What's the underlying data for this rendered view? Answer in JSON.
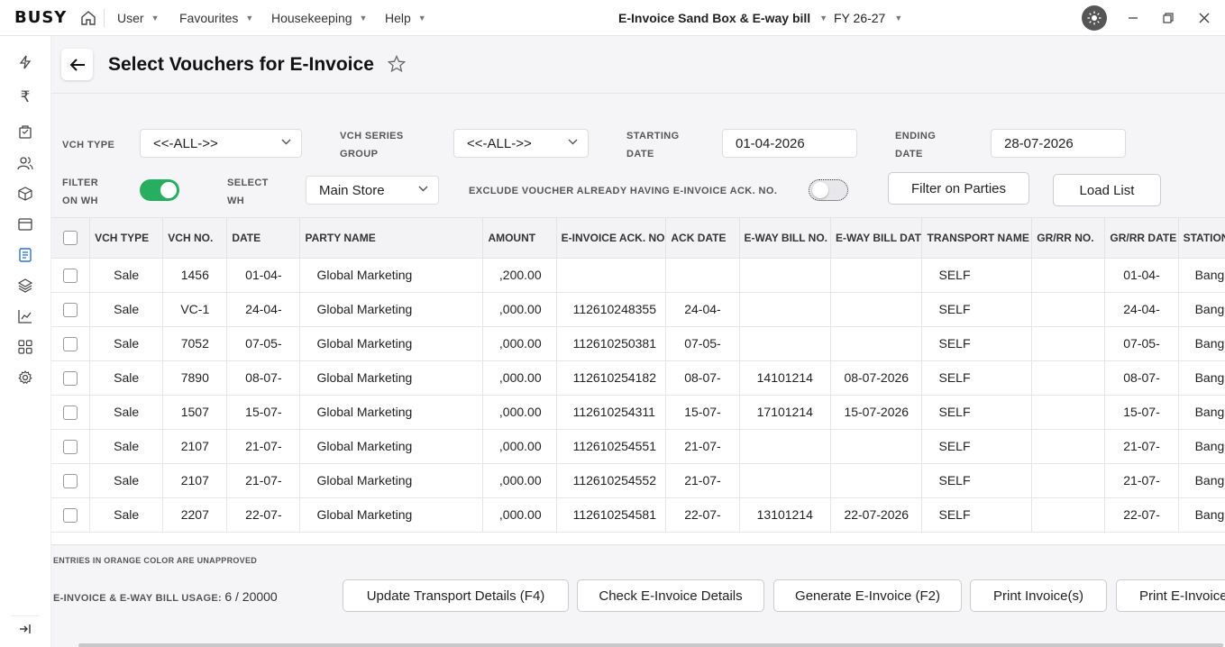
{
  "app": {
    "logo": "BUSY",
    "menus": [
      "User",
      "Favourites",
      "Housekeeping",
      "Help"
    ],
    "company": "E-Invoice Sand Box & E-way bill",
    "fy": "FY 26-27"
  },
  "page": {
    "title": "Select Vouchers for E-Invoice"
  },
  "filters": {
    "vch_type_label": "VCH TYPE",
    "vch_type_value": "<<-ALL->>",
    "vch_series_label_1": "VCH SERIES",
    "vch_series_label_2": "GROUP",
    "vch_series_value": "<<-ALL->>",
    "starting_label_1": "STARTING",
    "starting_label_2": "DATE",
    "starting_value": "01-04-2026",
    "ending_label_1": "ENDING",
    "ending_label_2": "DATE",
    "ending_value": "28-07-2026",
    "filter_wh_label_1": "FILTER",
    "filter_wh_label_2": "ON WH",
    "filter_wh_on": true,
    "select_wh_label_1": "SELECT",
    "select_wh_label_2": "WH",
    "select_wh_value": "Main Store",
    "exclude_label": "EXCLUDE VOUCHER ALREADY HAVING E-INVOICE ACK. NO.",
    "exclude_on": false,
    "filter_parties_btn": "Filter on Parties",
    "load_list_btn": "Load List"
  },
  "table": {
    "columns": [
      "VCH TYPE",
      "VCH NO.",
      "DATE",
      "PARTY NAME",
      "AMOUNT",
      "E-INVOICE ACK. NO.",
      "ACK DATE",
      "E-WAY BILL NO.",
      "E-WAY BILL DAT",
      "TRANSPORT NAME",
      "GR/RR NO.",
      "GR/RR DATE",
      "STATION"
    ],
    "rows": [
      [
        "Sale",
        "1456",
        "01-04-",
        "Global Marketing",
        ",200.00",
        "",
        "",
        "",
        "",
        "SELF",
        "",
        "01-04-",
        "Banglore"
      ],
      [
        "Sale",
        "VC-1",
        "24-04-",
        "Global Marketing",
        ",000.00",
        "112610248355",
        "24-04-",
        "",
        "",
        "SELF",
        "",
        "24-04-",
        "Banglore"
      ],
      [
        "Sale",
        "7052",
        "07-05-",
        "Global Marketing",
        ",000.00",
        "112610250381",
        "07-05-",
        "",
        "",
        "SELF",
        "",
        "07-05-",
        "Banglore"
      ],
      [
        "Sale",
        "7890",
        "08-07-",
        "Global Marketing",
        ",000.00",
        "112610254182",
        "08-07-",
        "14101214",
        "08-07-2026",
        "SELF",
        "",
        "08-07-",
        "Banglore"
      ],
      [
        "Sale",
        "1507",
        "15-07-",
        "Global Marketing",
        ",000.00",
        "112610254311",
        "15-07-",
        "17101214",
        "15-07-2026",
        "SELF",
        "",
        "15-07-",
        "Banglore"
      ],
      [
        "Sale",
        "2107",
        "21-07-",
        "Global Marketing",
        ",000.00",
        "112610254551",
        "21-07-",
        "",
        "",
        "SELF",
        "",
        "21-07-",
        "Banglore"
      ],
      [
        "Sale",
        "2107",
        "21-07-",
        "Global Marketing",
        ",000.00",
        "112610254552",
        "21-07-",
        "",
        "",
        "SELF",
        "",
        "21-07-",
        "Banglore"
      ],
      [
        "Sale",
        "2207",
        "22-07-",
        "Global Marketing",
        ",000.00",
        "112610254581",
        "22-07-",
        "13101214",
        "22-07-2026",
        "SELF",
        "",
        "22-07-",
        "Banglore"
      ]
    ]
  },
  "footer": {
    "note": "ENTRIES IN ORANGE COLOR ARE UNAPPROVED",
    "usage_label": "E-INVOICE & E-WAY BILL USAGE:",
    "usage_value": "6 / 20000",
    "buttons": [
      "Update Transport Details (F4)",
      "Check E-Invoice Details",
      "Generate E-Invoice (F2)",
      "Print Invoice(s)",
      "Print E-Invoice"
    ]
  },
  "colors": {
    "toggle_on": "#27ae60",
    "active_nav": "#2f6fd8"
  },
  "icons": {
    "sidebar": [
      "bolt-icon",
      "rupee-icon",
      "bag-icon",
      "users-icon",
      "box-icon",
      "card-icon",
      "document-icon",
      "layers-icon",
      "chart-icon",
      "grid-icon",
      "gear-icon"
    ]
  }
}
